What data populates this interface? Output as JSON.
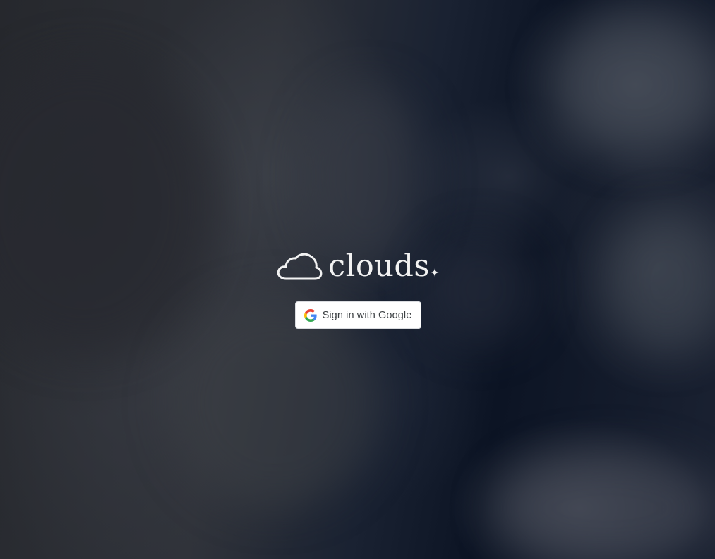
{
  "brand": {
    "name": "clouds",
    "icon": "cloud-icon",
    "accent_icon": "sparkle-icon",
    "text_color": "#f2f2f2"
  },
  "signin": {
    "label": "Sign in with Google",
    "icon": "google-icon",
    "background": "#ffffff",
    "text_color": "#3c4043"
  },
  "background": {
    "description_color": "#0f1624"
  }
}
